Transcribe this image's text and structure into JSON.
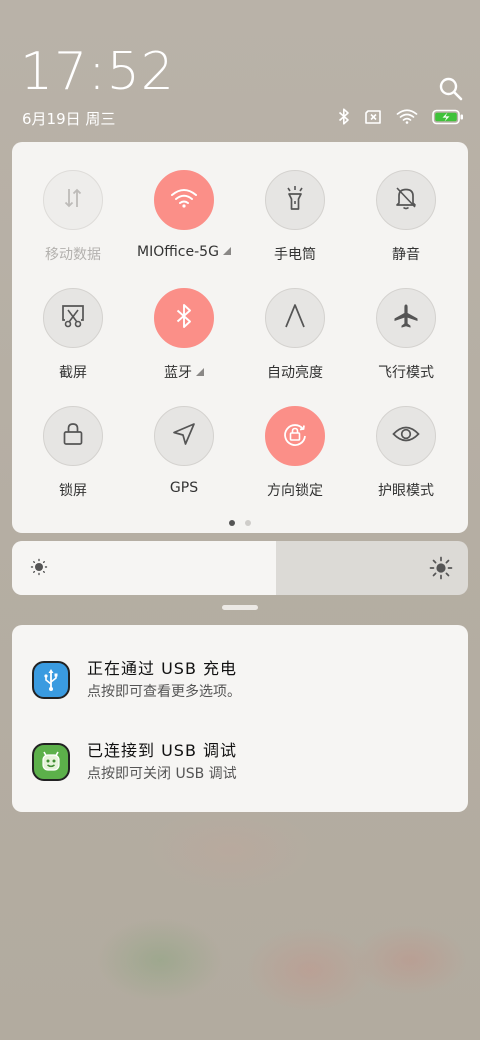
{
  "status": {
    "time": "17:52",
    "date": "6月19日 周三",
    "icons": [
      "bluetooth-icon",
      "no-sim-icon",
      "wifi-icon",
      "battery-charging-icon"
    ]
  },
  "tiles": [
    {
      "label": "移动数据",
      "icon": "mobile-data-icon",
      "state": "disabled"
    },
    {
      "label": "MIOffice-5G",
      "icon": "wifi-icon",
      "state": "on",
      "expandable": true
    },
    {
      "label": "手电筒",
      "icon": "flashlight-icon",
      "state": "off"
    },
    {
      "label": "静音",
      "icon": "mute-bell-icon",
      "state": "off"
    },
    {
      "label": "截屏",
      "icon": "screenshot-icon",
      "state": "off"
    },
    {
      "label": "蓝牙",
      "icon": "bluetooth-icon",
      "state": "on",
      "expandable": true
    },
    {
      "label": "自动亮度",
      "icon": "auto-brightness-icon",
      "state": "off"
    },
    {
      "label": "飞行模式",
      "icon": "airplane-icon",
      "state": "off"
    },
    {
      "label": "锁屏",
      "icon": "lock-icon",
      "state": "off"
    },
    {
      "label": "GPS",
      "icon": "gps-icon",
      "state": "off"
    },
    {
      "label": "方向锁定",
      "icon": "rotation-lock-icon",
      "state": "on"
    },
    {
      "label": "护眼模式",
      "icon": "eye-icon",
      "state": "off"
    }
  ],
  "page_indicator": {
    "current": 1,
    "total": 2
  },
  "brightness": {
    "level": 0.58
  },
  "notifications": [
    {
      "title": "正在通过 USB 充电",
      "body": "点按即可查看更多选项。",
      "icon": "usb-icon"
    },
    {
      "title": "已连接到 USB 调试",
      "body": "点按即可关闭 USB 调试",
      "icon": "android-debug-icon"
    }
  ],
  "colors": {
    "accent_on": "#fb8f88",
    "usb_icon_bg": "#3a9be0",
    "debug_icon_bg": "#5cb04a"
  }
}
